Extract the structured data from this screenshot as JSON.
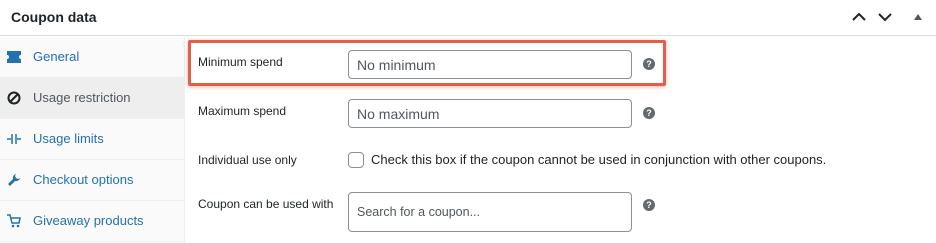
{
  "header": {
    "title": "Coupon data",
    "controls": [
      "chevron-up-icon",
      "chevron-down-icon",
      "toggle-arrow-icon"
    ]
  },
  "sidebar": {
    "items": [
      {
        "label": "General",
        "icon": "ticket-icon"
      },
      {
        "label": "Usage restriction",
        "icon": "block-icon",
        "active": true
      },
      {
        "label": "Usage limits",
        "icon": "limits-icon"
      },
      {
        "label": "Checkout options",
        "icon": "wrench-icon"
      },
      {
        "label": "Giveaway products",
        "icon": "cart-icon"
      }
    ]
  },
  "form": {
    "minimum_spend": {
      "label": "Minimum spend",
      "placeholder": "No minimum"
    },
    "maximum_spend": {
      "label": "Maximum spend",
      "placeholder": "No maximum"
    },
    "individual_use": {
      "label": "Individual use only",
      "checkbox_text": "Check this box if the coupon cannot be used in conjunction with other coupons.",
      "checked": false
    },
    "coupon_can_be_used_with": {
      "label": "Coupon can be used with",
      "placeholder": "Search for a coupon..."
    }
  },
  "colors": {
    "accent": "#2271b1",
    "highlight": "#e85c4a"
  }
}
